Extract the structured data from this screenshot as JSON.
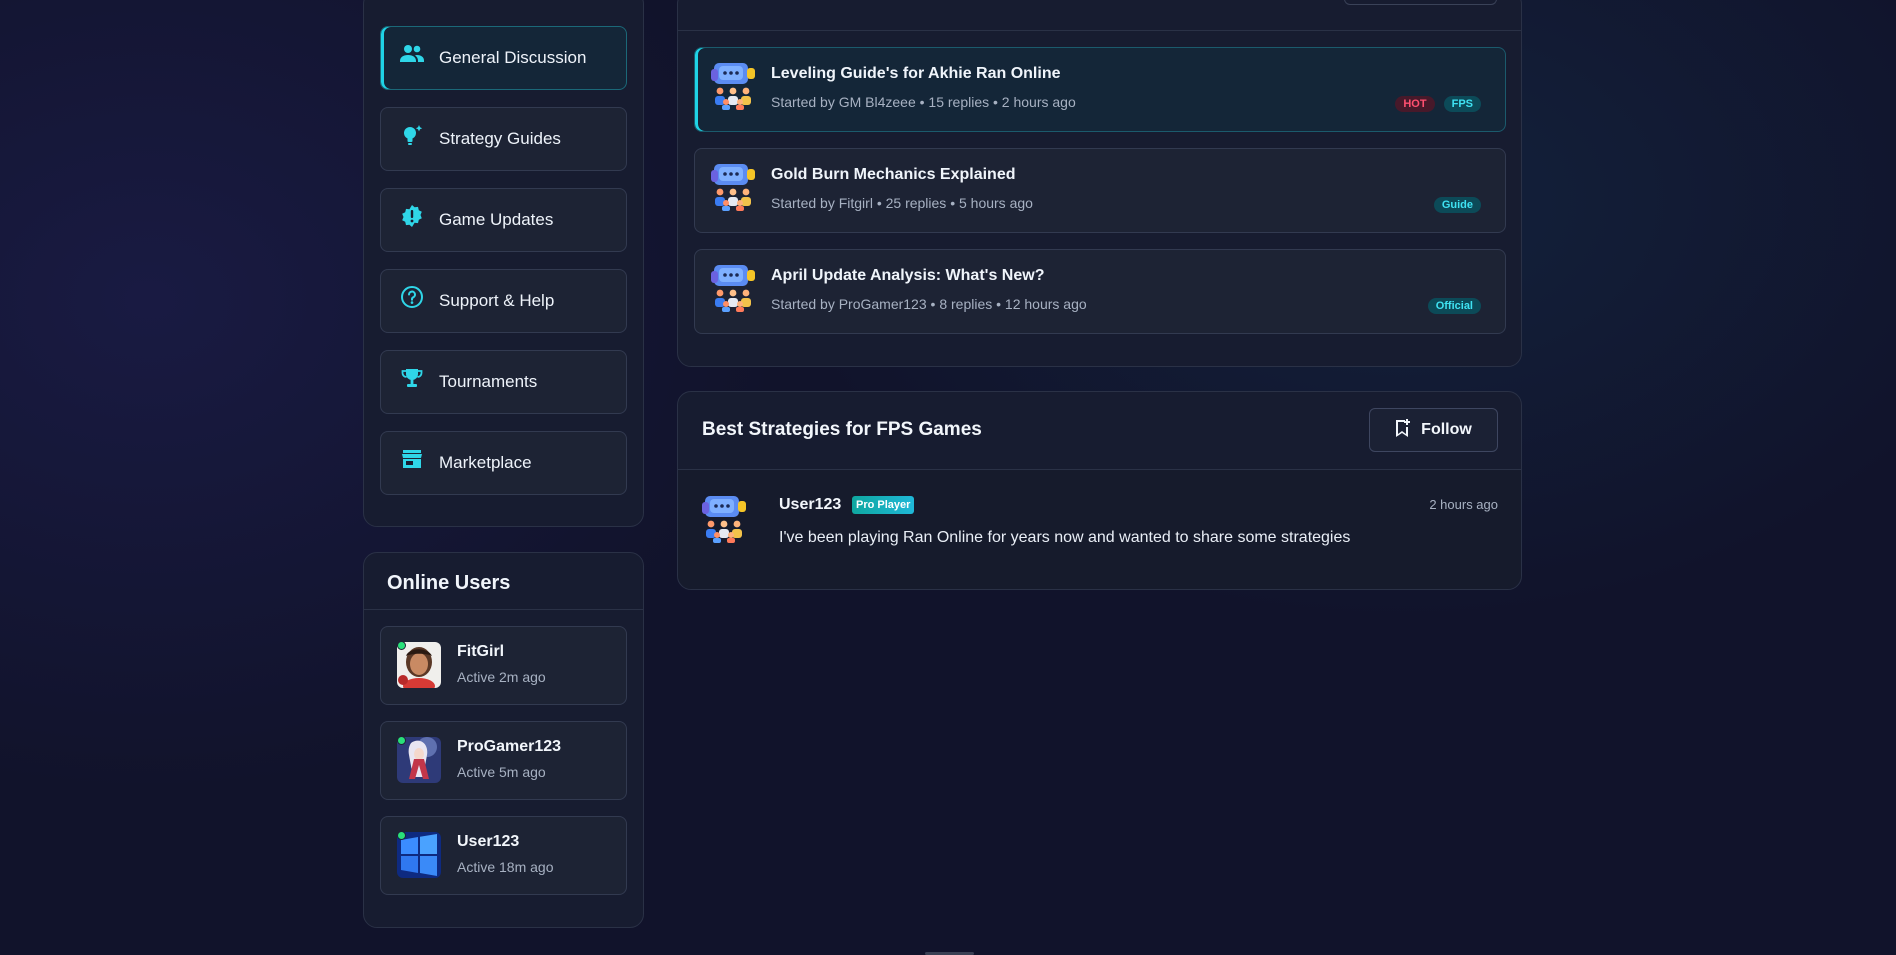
{
  "categories": [
    {
      "label": "General Discussion",
      "icon": "users-icon",
      "active": true
    },
    {
      "label": "Strategy Guides",
      "icon": "lightbulb-icon",
      "active": false
    },
    {
      "label": "Game Updates",
      "icon": "alert-badge-icon",
      "active": false
    },
    {
      "label": "Support & Help",
      "icon": "help-circle-icon",
      "active": false
    },
    {
      "label": "Tournaments",
      "icon": "trophy-icon",
      "active": false
    },
    {
      "label": "Marketplace",
      "icon": "store-icon",
      "active": false
    }
  ],
  "online_users": {
    "title": "Online Users",
    "users": [
      {
        "name": "FitGirl",
        "status": "Active 2m ago"
      },
      {
        "name": "ProGamer123",
        "status": "Active 5m ago"
      },
      {
        "name": "User123",
        "status": "Active 18m ago"
      }
    ]
  },
  "threads": [
    {
      "title": "Leveling Guide's for Akhie Ran Online",
      "meta": "Started by GM Bl4zeee • 15 replies • 2 hours ago",
      "tags": [
        "HOT",
        "FPS"
      ]
    },
    {
      "title": "Gold Burn Mechanics Explained",
      "meta": "Started by Fitgirl • 25 replies • 5 hours ago",
      "tags": [
        "Guide"
      ]
    },
    {
      "title": "April Update Analysis: What's New?",
      "meta": "Started by ProGamer123 • 8 replies • 12 hours ago",
      "tags": [
        "Official"
      ]
    }
  ],
  "post": {
    "title": "Best Strategies for FPS Games",
    "follow_label": "Follow",
    "author": "User123",
    "badge": "Pro Player",
    "time": "2 hours ago",
    "text": "I've been playing Ran Online for years now and wanted to share some strategies"
  },
  "colors": {
    "accent": "#1fd3e6",
    "hot": "#ff5070",
    "online": "#29e07a"
  }
}
